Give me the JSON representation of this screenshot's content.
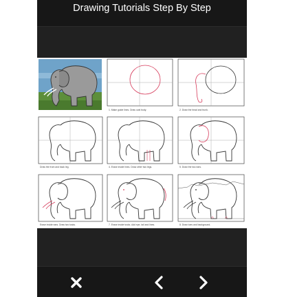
{
  "header": {
    "title": "Drawing Tutorials Step By Step"
  },
  "tutorial": {
    "steps": [
      {
        "caption": "1. Make guide lines. Draw oval body."
      },
      {
        "caption": "2. Draw the head and trunk."
      },
      {
        "caption": "Draw the front and back leg."
      },
      {
        "caption": "4. Erase inside lines. Draw other two legs."
      },
      {
        "caption": "5. Draw the two ears."
      },
      {
        "caption": "Erase inside ears. Draw two tusks."
      },
      {
        "caption": "7. Erase inside tusks. Add eye, tail and lines."
      },
      {
        "caption": "8. Draw toes and background."
      }
    ]
  },
  "toolbar": {
    "close_icon": "close-icon",
    "prev_icon": "chevron-left-icon",
    "next_icon": "chevron-right-icon"
  },
  "colors": {
    "app_background": "#212121",
    "bar_background": "#171717",
    "icon_color": "#ffffff",
    "sky": "#6fa3c9",
    "grass": "#5d8f3b",
    "ear_accent": "#d63a5a"
  }
}
